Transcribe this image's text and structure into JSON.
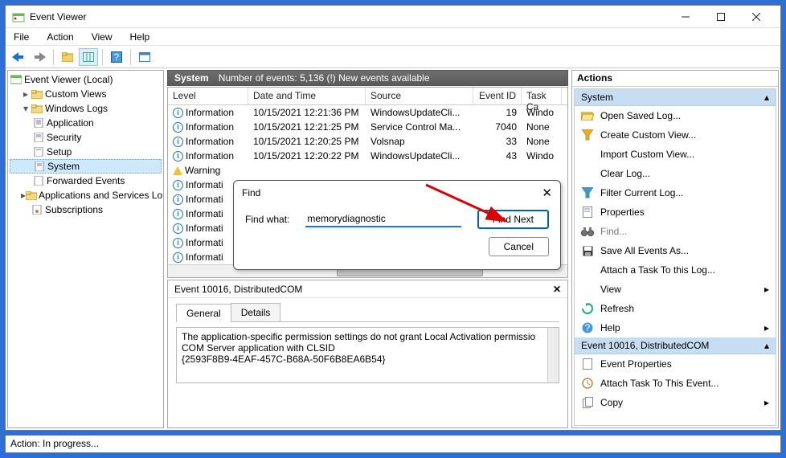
{
  "window_title": "Event Viewer",
  "menu": {
    "file": "File",
    "action": "Action",
    "view": "View",
    "help": "Help"
  },
  "tree": {
    "root": "Event Viewer (Local)",
    "custom_views": "Custom Views",
    "windows_logs": "Windows Logs",
    "application": "Application",
    "security": "Security",
    "setup": "Setup",
    "system": "System",
    "forwarded": "Forwarded Events",
    "app_services": "Applications and Services Lo",
    "subscriptions": "Subscriptions"
  },
  "center": {
    "header_name": "System",
    "header_count": "Number of events: 5,136 (!) New events available",
    "cols": {
      "level": "Level",
      "dt": "Date and Time",
      "src": "Source",
      "eid": "Event ID",
      "tc": "Task Ca"
    },
    "rows": [
      {
        "level": "Information",
        "icon": "info",
        "dt": "10/15/2021 12:21:36 PM",
        "src": "WindowsUpdateCli...",
        "eid": "19",
        "tc": "Windo"
      },
      {
        "level": "Information",
        "icon": "info",
        "dt": "10/15/2021 12:21:25 PM",
        "src": "Service Control Ma...",
        "eid": "7040",
        "tc": "None"
      },
      {
        "level": "Information",
        "icon": "info",
        "dt": "10/15/2021 12:20:25 PM",
        "src": "Volsnap",
        "eid": "33",
        "tc": "None"
      },
      {
        "level": "Information",
        "icon": "info",
        "dt": "10/15/2021 12:20:22 PM",
        "src": "WindowsUpdateCli...",
        "eid": "43",
        "tc": "Windo"
      },
      {
        "level": "Warning",
        "icon": "warn",
        "dt": "",
        "src": "",
        "eid": "",
        "tc": ""
      },
      {
        "level": "Informati",
        "icon": "info",
        "dt": "",
        "src": "",
        "eid": "",
        "tc": ""
      },
      {
        "level": "Informati",
        "icon": "info",
        "dt": "",
        "src": "",
        "eid": "",
        "tc": ""
      },
      {
        "level": "Informati",
        "icon": "info",
        "dt": "",
        "src": "",
        "eid": "",
        "tc": ""
      },
      {
        "level": "Informati",
        "icon": "info",
        "dt": "",
        "src": "",
        "eid": "",
        "tc": ""
      },
      {
        "level": "Informati",
        "icon": "info",
        "dt": "",
        "src": "",
        "eid": "",
        "tc": ""
      },
      {
        "level": "Informati",
        "icon": "info",
        "dt": "",
        "src": "",
        "eid": "",
        "tc": ""
      }
    ]
  },
  "detail": {
    "title": "Event 10016, DistributedCOM",
    "tab_general": "General",
    "tab_details": "Details",
    "line1": "The application-specific permission settings do not grant Local Activation permissio",
    "line2": "COM Server application with CLSID",
    "line3": "{2593F8B9-4EAF-457C-B68A-50F6B8EA6B54}"
  },
  "find": {
    "title": "Find",
    "label": "Find what:",
    "value": "memorydiagnostic",
    "next": "Find Next",
    "cancel": "Cancel"
  },
  "actions": {
    "title": "Actions",
    "group_system": "System",
    "open_saved": "Open Saved Log...",
    "create_custom": "Create Custom View...",
    "import_custom": "Import Custom View...",
    "clear_log": "Clear Log...",
    "filter_log": "Filter Current Log...",
    "properties": "Properties",
    "find": "Find...",
    "save_all": "Save All Events As...",
    "attach_task": "Attach a Task To this Log...",
    "view": "View",
    "refresh": "Refresh",
    "help": "Help",
    "group_event": "Event 10016, DistributedCOM",
    "event_props": "Event Properties",
    "attach_event": "Attach Task To This Event...",
    "copy": "Copy"
  },
  "status": "Action:  In progress..."
}
